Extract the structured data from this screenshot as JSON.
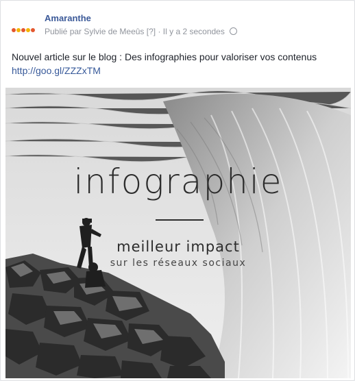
{
  "post": {
    "page_name": "Amaranthe",
    "meta_author": "Publié par Sylvie de Meeûs",
    "meta_help": "[?]",
    "meta_separator": "·",
    "meta_time": "Il y a 2 secondes",
    "privacy_icon": "globe-icon",
    "text": "Nouvel article sur le blog : Des infographies pour valoriser vos contenus",
    "link": "http://goo.gl/ZZZxTM"
  },
  "image": {
    "title": "infographie",
    "subtitle": "meilleur impact",
    "tagline": "sur les réseaux sociaux"
  }
}
